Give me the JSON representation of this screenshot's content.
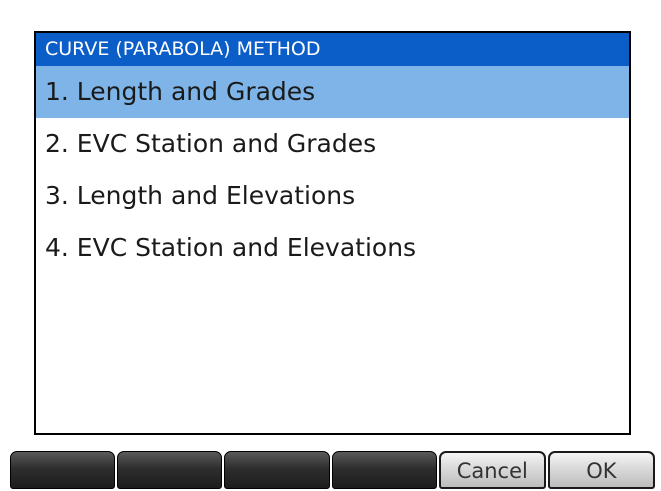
{
  "dialog": {
    "title": "CURVE (PARABOLA) METHOD",
    "items": [
      {
        "label": "1. Length and Grades",
        "selected": true
      },
      {
        "label": "2. EVC Station and Grades",
        "selected": false
      },
      {
        "label": "3. Length and Elevations",
        "selected": false
      },
      {
        "label": "4. EVC Station and Elevations",
        "selected": false
      }
    ]
  },
  "softkeys": [
    "",
    "",
    "",
    "",
    "Cancel",
    "OK"
  ],
  "colors": {
    "title_bar": "#0b5dc8",
    "selection": "#7eb4e8",
    "softkey_dark": "#2e2e2e",
    "softkey_light": "#d7d7d7"
  }
}
